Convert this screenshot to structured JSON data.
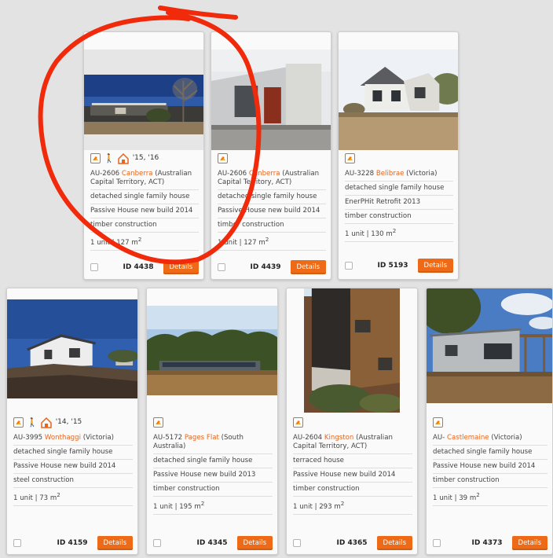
{
  "colors": {
    "accent": "#e8651e",
    "button": "#ef6a16",
    "annotation": "#f02a0a"
  },
  "icons": [
    "passive-house-certified-icon",
    "person-icon",
    "house-outline-icon",
    "checkbox"
  ],
  "cards": [
    {
      "code": "AU-2606",
      "city": "Canberra",
      "region": "(Australian Capital Territory, ACT)",
      "years": "'15, '16",
      "type": "detached single family house",
      "standard": "Passive House new build 2014",
      "construction": "timber construction",
      "units": "1 unit | 127 m",
      "units_sup": "2",
      "id": "ID 4438",
      "button": "Details"
    },
    {
      "code": "AU-2606",
      "city": "Canberra",
      "region": "(Australian Capital Territory, ACT)",
      "type": "detached single family house",
      "standard": "Passive House new build 2014",
      "construction": "timber construction",
      "units": "1 unit | 127 m",
      "units_sup": "2",
      "id": "ID 4439",
      "button": "Details"
    },
    {
      "code": "AU-3228",
      "city": "Belibrae",
      "region": "(Victoria)",
      "type": "detached single family house",
      "standard": "EnerPHit Retrofit 2013",
      "construction": "timber construction",
      "units": "1 unit | 130 m",
      "units_sup": "2",
      "id": "ID 5193",
      "button": "Details"
    },
    {
      "code": "AU-3995",
      "city": "Wonthaggi",
      "region": "(Victoria)",
      "years": "'14, '15",
      "type": "detached single family house",
      "standard": "Passive House new build 2014",
      "construction": "steel construction",
      "units": "1 unit | 73 m",
      "units_sup": "2",
      "id": "ID 4159",
      "button": "Details"
    },
    {
      "code": "AU-5172",
      "city": "Pages Flat",
      "region": "(South Australia)",
      "type": "detached single family house",
      "standard": "Passive House new build 2013",
      "construction": "timber construction",
      "units": "1 unit | 195 m",
      "units_sup": "2",
      "id": "ID 4345",
      "button": "Details"
    },
    {
      "code": "AU-2604",
      "city": "Kingston",
      "region": "(Australian Capital Territory, ACT)",
      "type": "terraced house",
      "standard": "Passive House new build 2014",
      "construction": "timber construction",
      "units": "1 unit | 293 m",
      "units_sup": "2",
      "id": "ID 4365",
      "button": "Details"
    },
    {
      "code": "AU-",
      "city": "Castlemaine",
      "region": "(Victoria)",
      "type": "detached single family house",
      "standard": "Passive House new build 2014",
      "construction": "timber construction",
      "units": "1 unit | 39 m",
      "units_sup": "2",
      "id": "ID 4373",
      "button": "Details"
    }
  ]
}
